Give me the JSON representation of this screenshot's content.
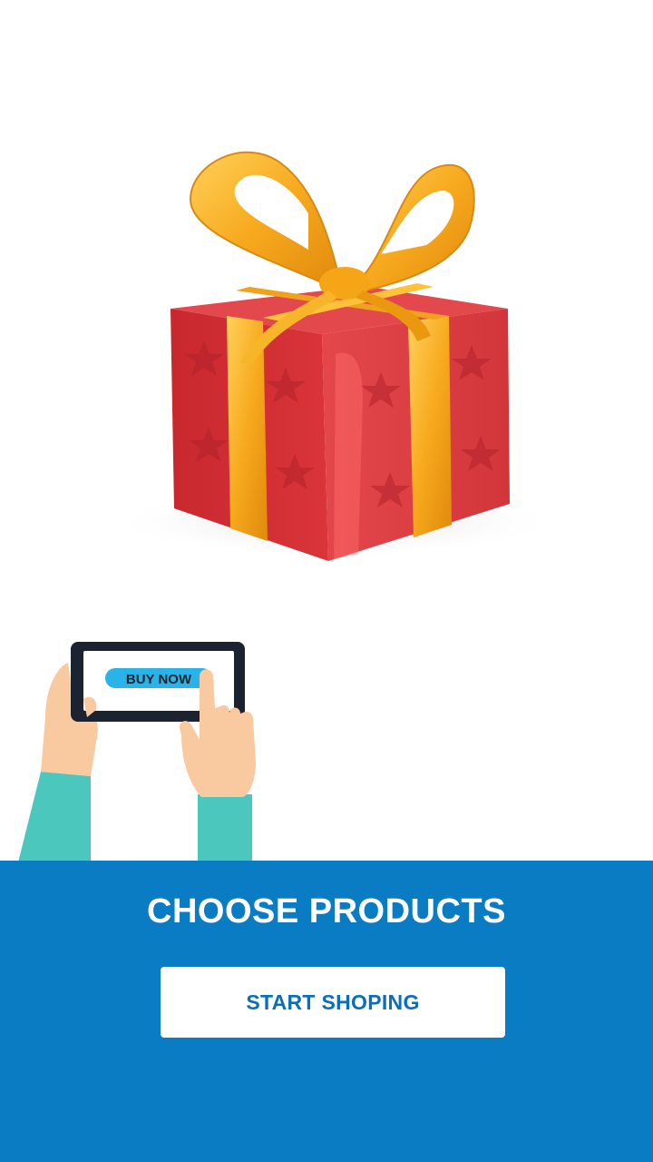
{
  "illustration": {
    "gift_icon": "gift-box-with-bow",
    "hands_icon": "hands-holding-tablet",
    "tablet_button_text": "BUY NOW"
  },
  "panel": {
    "headline": "CHOOSE PRODUCTS",
    "button_label": "START SHOPING",
    "background_color": "#0a7cc4",
    "button_text_color": "#0a6fb8"
  }
}
